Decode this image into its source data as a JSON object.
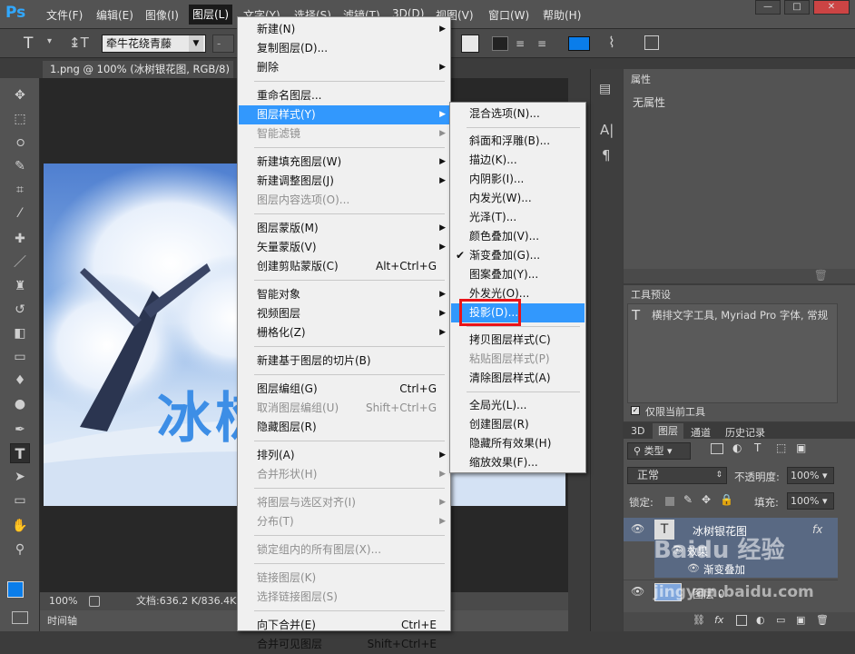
{
  "app": {
    "logo": "Ps"
  },
  "menubar": {
    "items": [
      "文件(F)",
      "编辑(E)",
      "图像(I)",
      "图层(L)",
      "文字(Y)",
      "选择(S)",
      "滤镜(T)",
      "3D(D)",
      "视图(V)",
      "窗口(W)",
      "帮助(H)"
    ],
    "active": "图层(L)",
    "window_buttons": [
      "—",
      "□",
      "✕"
    ]
  },
  "options": {
    "font_family": "牵牛花绕青藤",
    "font_style": "-"
  },
  "document": {
    "tab_title": "1.png @ 100% (冰树银花图, RGB/8) *",
    "overlay_text": "冰树",
    "zoom": "100%",
    "file_info": "文档:636.2 K/836.4K",
    "timeline": "时间轴"
  },
  "layer_menu": {
    "items": [
      {
        "label": "新建(N)",
        "submenu": true
      },
      {
        "label": "复制图层(D)..."
      },
      {
        "label": "删除",
        "submenu": true
      },
      {
        "sep": true
      },
      {
        "label": "重命名图层..."
      },
      {
        "label": "图层样式(Y)",
        "submenu": true,
        "highlighted": true
      },
      {
        "label": "智能滤镜",
        "submenu": true,
        "disabled": true
      },
      {
        "sep": true
      },
      {
        "label": "新建填充图层(W)",
        "submenu": true
      },
      {
        "label": "新建调整图层(J)",
        "submenu": true
      },
      {
        "label": "图层内容选项(O)...",
        "disabled": true
      },
      {
        "sep": true
      },
      {
        "label": "图层蒙版(M)",
        "submenu": true
      },
      {
        "label": "矢量蒙版(V)",
        "submenu": true
      },
      {
        "label": "创建剪贴蒙版(C)",
        "shortcut": "Alt+Ctrl+G"
      },
      {
        "sep": true
      },
      {
        "label": "智能对象",
        "submenu": true
      },
      {
        "label": "视频图层",
        "submenu": true
      },
      {
        "label": "栅格化(Z)",
        "submenu": true
      },
      {
        "sep": true
      },
      {
        "label": "新建基于图层的切片(B)"
      },
      {
        "sep": true
      },
      {
        "label": "图层编组(G)",
        "shortcut": "Ctrl+G"
      },
      {
        "label": "取消图层编组(U)",
        "shortcut": "Shift+Ctrl+G",
        "disabled": true
      },
      {
        "label": "隐藏图层(R)"
      },
      {
        "sep": true
      },
      {
        "label": "排列(A)",
        "submenu": true
      },
      {
        "label": "合并形状(H)",
        "submenu": true,
        "disabled": true
      },
      {
        "sep": true
      },
      {
        "label": "将图层与选区对齐(I)",
        "submenu": true,
        "disabled": true
      },
      {
        "label": "分布(T)",
        "submenu": true,
        "disabled": true
      },
      {
        "sep": true
      },
      {
        "label": "锁定组内的所有图层(X)...",
        "disabled": true
      },
      {
        "sep": true
      },
      {
        "label": "链接图层(K)",
        "disabled": true
      },
      {
        "label": "选择链接图层(S)",
        "disabled": true
      },
      {
        "sep": true
      },
      {
        "label": "向下合并(E)",
        "shortcut": "Ctrl+E"
      },
      {
        "label": "合并可见图层",
        "shortcut": "Shift+Ctrl+E"
      }
    ]
  },
  "style_menu": {
    "items": [
      {
        "label": "混合选项(N)..."
      },
      {
        "sep": true
      },
      {
        "label": "斜面和浮雕(B)..."
      },
      {
        "label": "描边(K)..."
      },
      {
        "label": "内阴影(I)..."
      },
      {
        "label": "内发光(W)..."
      },
      {
        "label": "光泽(T)..."
      },
      {
        "label": "颜色叠加(V)..."
      },
      {
        "label": "渐变叠加(G)...",
        "checked": true
      },
      {
        "label": "图案叠加(Y)..."
      },
      {
        "label": "外发光(O)..."
      },
      {
        "label": "投影(D)...",
        "highlighted": true
      },
      {
        "sep": true
      },
      {
        "label": "拷贝图层样式(C)"
      },
      {
        "label": "粘贴图层样式(P)",
        "disabled": true
      },
      {
        "label": "清除图层样式(A)"
      },
      {
        "sep": true
      },
      {
        "label": "全局光(L)..."
      },
      {
        "label": "创建图层(R)"
      },
      {
        "label": "隐藏所有效果(H)"
      },
      {
        "label": "缩放效果(F)..."
      }
    ]
  },
  "properties": {
    "title": "属性",
    "content": "无属性"
  },
  "tool_presets": {
    "title": "工具预设",
    "item": "横排文字工具, Myriad Pro 字体, 常规",
    "checkbox": "仅限当前工具"
  },
  "layers_panel": {
    "tabs": [
      "3D",
      "图层",
      "通道",
      "历史记录"
    ],
    "active_tab": "图层",
    "filter": "类型",
    "blend_mode": "正常",
    "opacity_label": "不透明度:",
    "opacity": "100%",
    "lock_label": "锁定:",
    "fill_label": "填充:",
    "fill": "100%",
    "layers": [
      {
        "name": "冰树银花图",
        "type": "text",
        "fx": "fx"
      },
      {
        "name": "效果",
        "type": "effect-group"
      },
      {
        "name": "渐变叠加",
        "type": "effect"
      },
      {
        "name": "图层 0",
        "type": "image"
      }
    ]
  },
  "watermark": {
    "line1": "Baidu 经验",
    "line2": "jingyan.baidu.com"
  },
  "colors": {
    "accent": "#3298fd",
    "red_box": "#e8141a",
    "ps_blue": "#31a8ff"
  }
}
